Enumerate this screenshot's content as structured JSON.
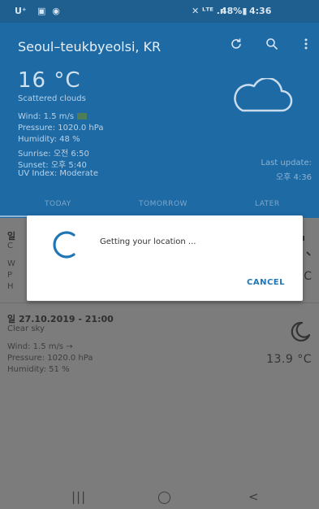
{
  "status_bar": {
    "carrier": "U⁺",
    "left_icons": "▣ ◉",
    "right_icons": "✕ ᴸᵀᴱ .ıl",
    "battery": "48%▮",
    "time": "4:36"
  },
  "header": {
    "city": "Seoul–teukbyeolsi, KR",
    "icons": [
      "refresh-icon",
      "search-icon",
      "more-vert-icon"
    ]
  },
  "current": {
    "temperature": "16 °C",
    "description": "Scattered clouds",
    "wind": "Wind: 1.5 m/s",
    "pressure": "Pressure: 1020.0 hPa",
    "humidity": "Humidity: 48 %",
    "sunrise": "Sunrise: 오전 6:50",
    "sunset": "Sunset: 오후 5:40",
    "uv_index": "UV Index: Moderate",
    "last_update_label": "Last update:",
    "last_update_time": "오후 4:36"
  },
  "tabs": [
    "TODAY",
    "TOMORROW",
    "LATER"
  ],
  "selected_tab": "TODAY",
  "forecast": [
    {
      "title": "일",
      "subtitle": "C",
      "wind": "W",
      "pressure": "P",
      "humidity": "H",
      "temperature": "C",
      "icon": "partly-visible-weather-icon"
    },
    {
      "title": "일 27.10.2019 - 21:00",
      "subtitle": "Clear sky",
      "wind": "Wind: 1.5 m/s →",
      "pressure": "Pressure: 1020.0 hPa",
      "humidity": "Humidity: 51 %",
      "temperature": "13.9 °C",
      "icon": "moon-icon"
    }
  ],
  "dialog": {
    "message": "Getting your location ...",
    "cancel_label": "CANCEL"
  },
  "nav_bar": {
    "recents": "|||",
    "home": "◯",
    "back": "<"
  },
  "colors": {
    "header_bg": "#1e6aa5",
    "status_bg": "#1e5f8f",
    "scrim_content": "#7c7c7c",
    "accent": "#1f76b6"
  }
}
